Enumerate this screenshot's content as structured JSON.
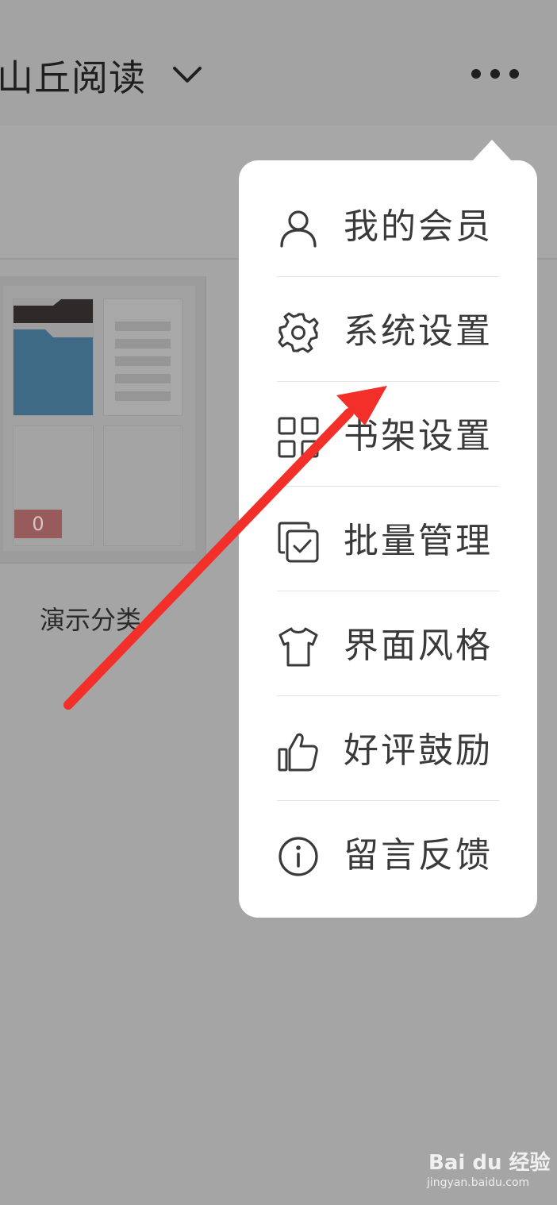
{
  "header": {
    "title": "山丘阅读",
    "title_dropdown_icon": "chevron-down-icon",
    "more_icon": "more-horizontal-icon"
  },
  "shelf": {
    "folder": {
      "name": "演示分类",
      "count": "0"
    }
  },
  "popup_menu": {
    "items": [
      {
        "label": "我的会员",
        "icon": "user-icon"
      },
      {
        "label": "系统设置",
        "icon": "gear-icon"
      },
      {
        "label": "书架设置",
        "icon": "grid-icon"
      },
      {
        "label": "批量管理",
        "icon": "batch-check-icon"
      },
      {
        "label": "界面风格",
        "icon": "tshirt-icon"
      },
      {
        "label": "好评鼓励",
        "icon": "thumbs-up-icon"
      },
      {
        "label": "留言反馈",
        "icon": "info-icon"
      }
    ]
  },
  "annotation": {
    "color": "#f22f28",
    "icon": "red-arrow-icon"
  },
  "watermark": {
    "brand": "Bai du 经验",
    "url": "jingyan.baidu.com"
  },
  "colors": {
    "overlay": "#a5a5a5",
    "menu_bg": "#ffffff",
    "menu_text": "#3a3a3a",
    "badge": "#985b5b"
  }
}
